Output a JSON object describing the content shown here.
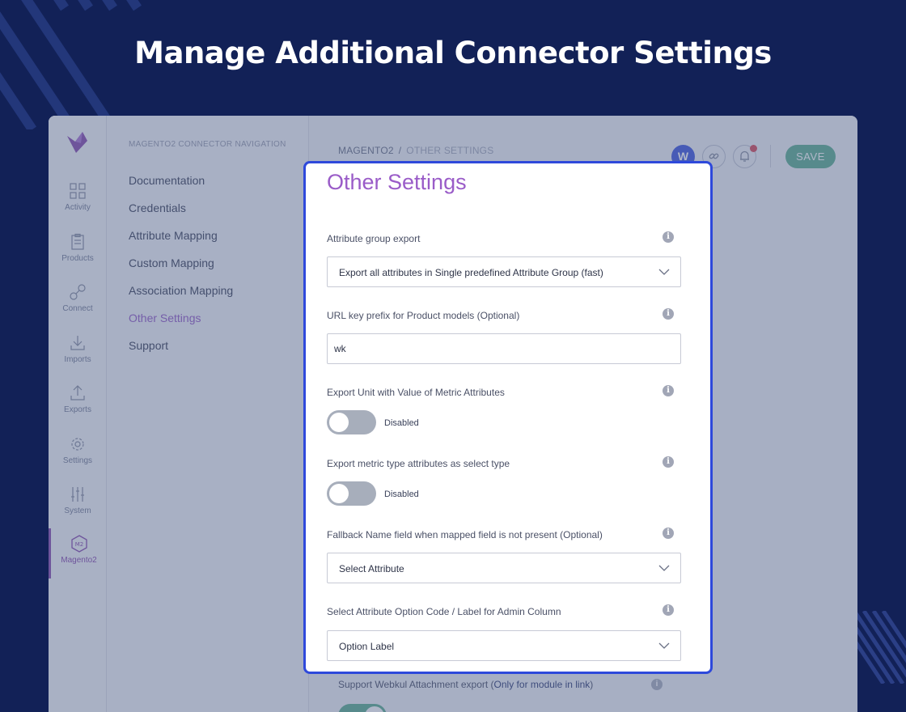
{
  "hero": {
    "title": "Manage Additional Connector Settings"
  },
  "rail": {
    "items": [
      {
        "label": "Activity",
        "icon": "grid-icon"
      },
      {
        "label": "Products",
        "icon": "clipboard-icon"
      },
      {
        "label": "Connect",
        "icon": "connect-icon"
      },
      {
        "label": "Imports",
        "icon": "import-icon"
      },
      {
        "label": "Exports",
        "icon": "export-icon"
      },
      {
        "label": "Settings",
        "icon": "gear-icon"
      },
      {
        "label": "System",
        "icon": "sliders-icon"
      },
      {
        "label": "Magento2",
        "icon": "magento2-icon",
        "active": true
      }
    ]
  },
  "nav": {
    "heading": "MAGENTO2 CONNECTOR NAVIGATION",
    "links": [
      "Documentation",
      "Credentials",
      "Attribute Mapping",
      "Custom Mapping",
      "Association Mapping",
      "Other Settings",
      "Support"
    ],
    "active": "Other Settings"
  },
  "breadcrumb": {
    "root": "MAGENTO2",
    "separator": "/",
    "current": "OTHER SETTINGS"
  },
  "toolbar": {
    "save_label": "SAVE",
    "avatar_letter": "W"
  },
  "panel": {
    "title": "Other Settings",
    "fields": {
      "attribute_group_export": {
        "label": "Attribute group export",
        "value": "Export all attributes in Single predefined Attribute Group (fast)"
      },
      "url_key_prefix": {
        "label": "URL key prefix for Product models (Optional)",
        "value": "wk"
      },
      "export_unit": {
        "label": "Export Unit with Value of Metric Attributes",
        "state": "Disabled"
      },
      "metric_as_select": {
        "label": "Export metric type attributes as select type",
        "state": "Disabled"
      },
      "fallback_name": {
        "label": "Fallback Name field when mapped field is not present (Optional)",
        "value": "Select Attribute"
      },
      "option_code_label": {
        "label": "Select Attribute Option Code / Label for Admin Column",
        "value": "Option Label"
      }
    },
    "info_glyph": "i"
  },
  "background_row": {
    "label_prefix": "Support Webkul Attachment export (",
    "label_bold": "Only for module in link",
    "label_suffix": ")"
  },
  "colors": {
    "page_bg": "#122157",
    "accent_purple": "#9a5cc8",
    "panel_border": "#2e49db",
    "save_green": "#4ea786",
    "toggle_off": "#a7aebb"
  }
}
